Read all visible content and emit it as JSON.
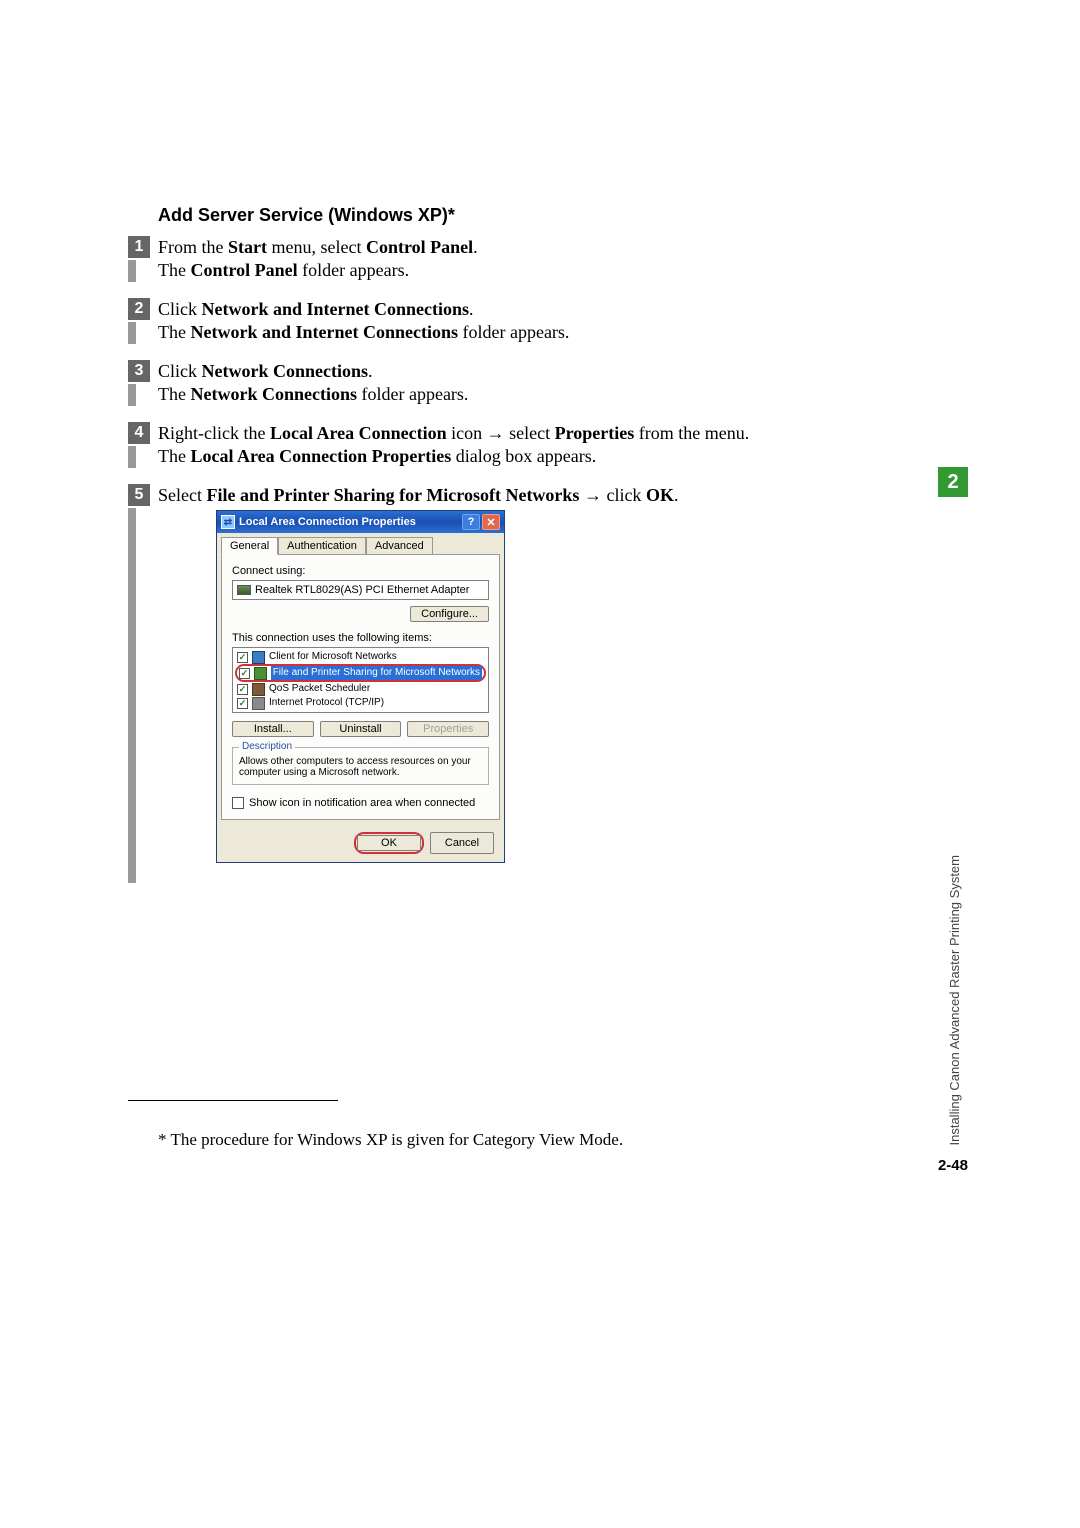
{
  "heading": "Add Server Service (Windows XP)*",
  "steps": {
    "s1": {
      "num": "1",
      "line1_a": "From the ",
      "line1_b": "Start",
      "line1_c": " menu, select ",
      "line1_d": "Control Panel",
      "line1_e": ".",
      "line2_a": "The ",
      "line2_b": "Control Panel",
      "line2_c": " folder appears."
    },
    "s2": {
      "num": "2",
      "line1_a": "Click ",
      "line1_b": "Network and Internet Connections",
      "line1_c": ".",
      "line2_a": "The ",
      "line2_b": "Network and Internet Connections",
      "line2_c": " folder appears."
    },
    "s3": {
      "num": "3",
      "line1_a": "Click ",
      "line1_b": "Network Connections",
      "line1_c": ".",
      "line2_a": "The ",
      "line2_b": "Network Connections",
      "line2_c": " folder appears."
    },
    "s4": {
      "num": "4",
      "line1_a": "Right-click the ",
      "line1_b": "Local Area Connection",
      "line1_c": " icon ",
      "arrow": "→",
      "line1_d": " select ",
      "line1_e": "Properties",
      "line1_f": " from the menu.",
      "line2_a": "The ",
      "line2_b": "Local Area Connection Properties",
      "line2_c": " dialog box appears."
    },
    "s5": {
      "num": "5",
      "line1_a": "Select ",
      "line1_b": "File and Printer Sharing for Microsoft Networks",
      "line1_c": " ",
      "arrow": "→",
      "line1_d": " click ",
      "line1_e": "OK",
      "line1_f": "."
    }
  },
  "dialog": {
    "title": "Local Area Connection Properties",
    "tabs": {
      "general": "General",
      "auth": "Authentication",
      "adv": "Advanced"
    },
    "connect_using": "Connect using:",
    "adapter": "Realtek RTL8029(AS) PCI Ethernet Adapter",
    "configure": "Configure...",
    "items_label": "This connection uses the following items:",
    "items": {
      "client": "Client for Microsoft Networks",
      "fileprint": "File and Printer Sharing for Microsoft Networks",
      "qos": "QoS Packet Scheduler",
      "tcpip": "Internet Protocol (TCP/IP)"
    },
    "install": "Install...",
    "uninstall": "Uninstall",
    "properties": "Properties",
    "desc_legend": "Description",
    "desc_text": "Allows other computers to access resources on your computer using a Microsoft network.",
    "show_icon": "Show icon in notification area when connected",
    "ok": "OK",
    "cancel": "Cancel"
  },
  "side": {
    "chapter": "2",
    "text": "Installing Canon Advanced Raster Printing System"
  },
  "footnote": "*  The procedure for Windows XP is given for Category View Mode.",
  "page_num": "2-48"
}
